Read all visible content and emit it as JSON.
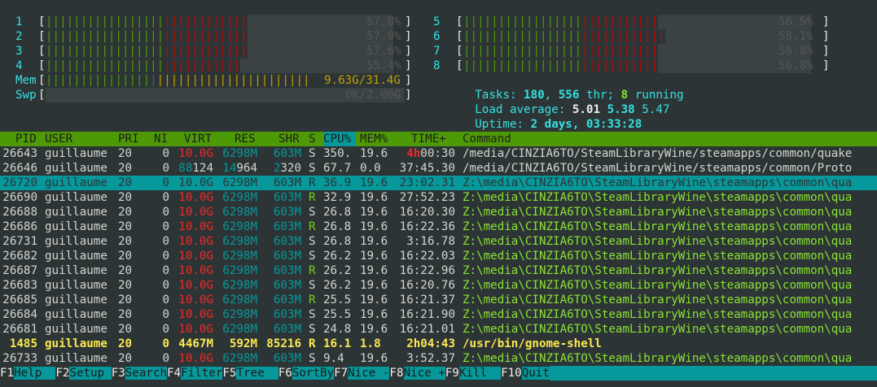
{
  "cpus_left": [
    {
      "id": "1",
      "pct": "57.8%"
    },
    {
      "id": "2",
      "pct": "57.9%"
    },
    {
      "id": "3",
      "pct": "57.6%"
    },
    {
      "id": "4",
      "pct": "55.4%"
    }
  ],
  "cpus_right": [
    {
      "id": "5",
      "pct": "56.5%"
    },
    {
      "id": "6",
      "pct": "58.1%"
    },
    {
      "id": "7",
      "pct": "56.8%"
    },
    {
      "id": "8",
      "pct": "56.8%"
    }
  ],
  "mem": {
    "label": "Mem",
    "value": "9.63G/31.4G"
  },
  "swp": {
    "label": "Swp",
    "value": "0K/2.00G"
  },
  "tasks": {
    "label": "Tasks:",
    "count": "180",
    "threads": "556",
    "thr_label": "thr;",
    "running": "8",
    "running_label": "running"
  },
  "load": {
    "label": "Load average:",
    "l1": "5.01",
    "l5": "5.38",
    "l15": "5.47"
  },
  "uptime": {
    "label": "Uptime:",
    "value": "2 days, 03:33:28"
  },
  "columns": {
    "pid": "PID",
    "user": "USER",
    "pri": "PRI",
    "ni": "NI",
    "virt": "VIRT",
    "res": "RES",
    "shr": "SHR",
    "s": "S",
    "cpu": "CPU%",
    "mem": "MEM%",
    "time": "TIME+",
    "cmd": "Command"
  },
  "processes": [
    {
      "pid": "26643",
      "user": "guillaume",
      "pri": "20",
      "ni": "0",
      "virt": "10.0G",
      "res": "6298M",
      "shr": "603M",
      "s": "S",
      "cpu": "350.",
      "mem": "19.6",
      "time_h": "4h",
      "time_r": "00:30",
      "cmd": "/media/CINZIA6TO/SteamLibraryWine/steamapps/common/quake"
    },
    {
      "pid": "26646",
      "user": "guillaume",
      "pri": "20",
      "ni": "0",
      "virt_a": "88",
      "virt_b": "124",
      "res_a": "14",
      "res_b": "964",
      "shr_a": "2",
      "shr_b": "320",
      "s": "S",
      "cpu": "67.7",
      "mem": "0.0",
      "time": "37:45.30",
      "cmd": "/media/CINZIA6TO/SteamLibraryWine/steamapps/common/Proto"
    },
    {
      "pid": "26720",
      "user": "guillaume",
      "pri": "20",
      "ni": "0",
      "virt": "10.0G",
      "res": "6298M",
      "shr": "603M",
      "s": "R",
      "cpu": "36.9",
      "mem": "19.6",
      "time": "23:02.31",
      "cmd": "Z:\\media\\CINZIA6TO\\SteamLibraryWine\\steamapps\\common\\qua"
    },
    {
      "pid": "26690",
      "user": "guillaume",
      "pri": "20",
      "ni": "0",
      "virt": "10.0G",
      "res": "6298M",
      "shr": "603M",
      "s": "R",
      "cpu": "32.9",
      "mem": "19.6",
      "time": "27:52.23",
      "cmd": "Z:\\media\\CINZIA6TO\\SteamLibraryWine\\steamapps\\common\\qua"
    },
    {
      "pid": "26688",
      "user": "guillaume",
      "pri": "20",
      "ni": "0",
      "virt": "10.0G",
      "res": "6298M",
      "shr": "603M",
      "s": "S",
      "cpu": "26.8",
      "mem": "19.6",
      "time": "16:20.30",
      "cmd": "Z:\\media\\CINZIA6TO\\SteamLibraryWine\\steamapps\\common\\qua"
    },
    {
      "pid": "26686",
      "user": "guillaume",
      "pri": "20",
      "ni": "0",
      "virt": "10.0G",
      "res": "6298M",
      "shr": "603M",
      "s": "R",
      "cpu": "26.8",
      "mem": "19.6",
      "time": "16:22.36",
      "cmd": "Z:\\media\\CINZIA6TO\\SteamLibraryWine\\steamapps\\common\\qua"
    },
    {
      "pid": "26731",
      "user": "guillaume",
      "pri": "20",
      "ni": "0",
      "virt": "10.0G",
      "res": "6298M",
      "shr": "603M",
      "s": "S",
      "cpu": "26.8",
      "mem": "19.6",
      "time": "3:16.78",
      "cmd": "Z:\\media\\CINZIA6TO\\SteamLibraryWine\\steamapps\\common\\qua"
    },
    {
      "pid": "26682",
      "user": "guillaume",
      "pri": "20",
      "ni": "0",
      "virt": "10.0G",
      "res": "6298M",
      "shr": "603M",
      "s": "S",
      "cpu": "26.2",
      "mem": "19.6",
      "time": "16:22.03",
      "cmd": "Z:\\media\\CINZIA6TO\\SteamLibraryWine\\steamapps\\common\\qua"
    },
    {
      "pid": "26687",
      "user": "guillaume",
      "pri": "20",
      "ni": "0",
      "virt": "10.0G",
      "res": "6298M",
      "shr": "603M",
      "s": "R",
      "cpu": "26.2",
      "mem": "19.6",
      "time": "16:22.96",
      "cmd": "Z:\\media\\CINZIA6TO\\SteamLibraryWine\\steamapps\\common\\qua"
    },
    {
      "pid": "26683",
      "user": "guillaume",
      "pri": "20",
      "ni": "0",
      "virt": "10.0G",
      "res": "6298M",
      "shr": "603M",
      "s": "S",
      "cpu": "26.2",
      "mem": "19.6",
      "time": "16:20.76",
      "cmd": "Z:\\media\\CINZIA6TO\\SteamLibraryWine\\steamapps\\common\\qua"
    },
    {
      "pid": "26685",
      "user": "guillaume",
      "pri": "20",
      "ni": "0",
      "virt": "10.0G",
      "res": "6298M",
      "shr": "603M",
      "s": "R",
      "cpu": "25.5",
      "mem": "19.6",
      "time": "16:21.37",
      "cmd": "Z:\\media\\CINZIA6TO\\SteamLibraryWine\\steamapps\\common\\qua"
    },
    {
      "pid": "26684",
      "user": "guillaume",
      "pri": "20",
      "ni": "0",
      "virt": "10.0G",
      "res": "6298M",
      "shr": "603M",
      "s": "S",
      "cpu": "25.5",
      "mem": "19.6",
      "time": "16:21.90",
      "cmd": "Z:\\media\\CINZIA6TO\\SteamLibraryWine\\steamapps\\common\\qua"
    },
    {
      "pid": "26681",
      "user": "guillaume",
      "pri": "20",
      "ni": "0",
      "virt": "10.0G",
      "res": "6298M",
      "shr": "603M",
      "s": "S",
      "cpu": "24.8",
      "mem": "19.6",
      "time": "16:21.01",
      "cmd": "Z:\\media\\CINZIA6TO\\SteamLibraryWine\\steamapps\\common\\qua"
    },
    {
      "pid": "1485",
      "user": "guillaume",
      "pri": "20",
      "ni": "0",
      "virt": "4467M",
      "res": "592M",
      "shr": "85216",
      "s": "R",
      "cpu": "16.1",
      "mem": "1.8",
      "time": "2h04:43",
      "cmd": "/usr/bin/gnome-shell"
    },
    {
      "pid": "26733",
      "user": "guillaume",
      "pri": "20",
      "ni": "0",
      "virt": "10.0G",
      "res": "6298M",
      "shr": "603M",
      "s": "S",
      "cpu": "9.4",
      "mem": "19.6",
      "time": "3:52.37",
      "cmd": "Z:\\media\\CINZIA6TO\\SteamLibraryWine\\steamapps\\common\\qua"
    }
  ],
  "footer": [
    {
      "key": "F1",
      "label": "Help  "
    },
    {
      "key": "F2",
      "label": "Setup "
    },
    {
      "key": "F3",
      "label": "Search"
    },
    {
      "key": "F4",
      "label": "Filter"
    },
    {
      "key": "F5",
      "label": "Tree  "
    },
    {
      "key": "F6",
      "label": "SortBy"
    },
    {
      "key": "F7",
      "label": "Nice -"
    },
    {
      "key": "F8",
      "label": "Nice +"
    },
    {
      "key": "F9",
      "label": "Kill  "
    },
    {
      "key": "F10",
      "label": "Quit"
    }
  ],
  "colors": {
    "accent": "#4e9a06",
    "selection": "#06989a",
    "background": "#2d3436"
  }
}
